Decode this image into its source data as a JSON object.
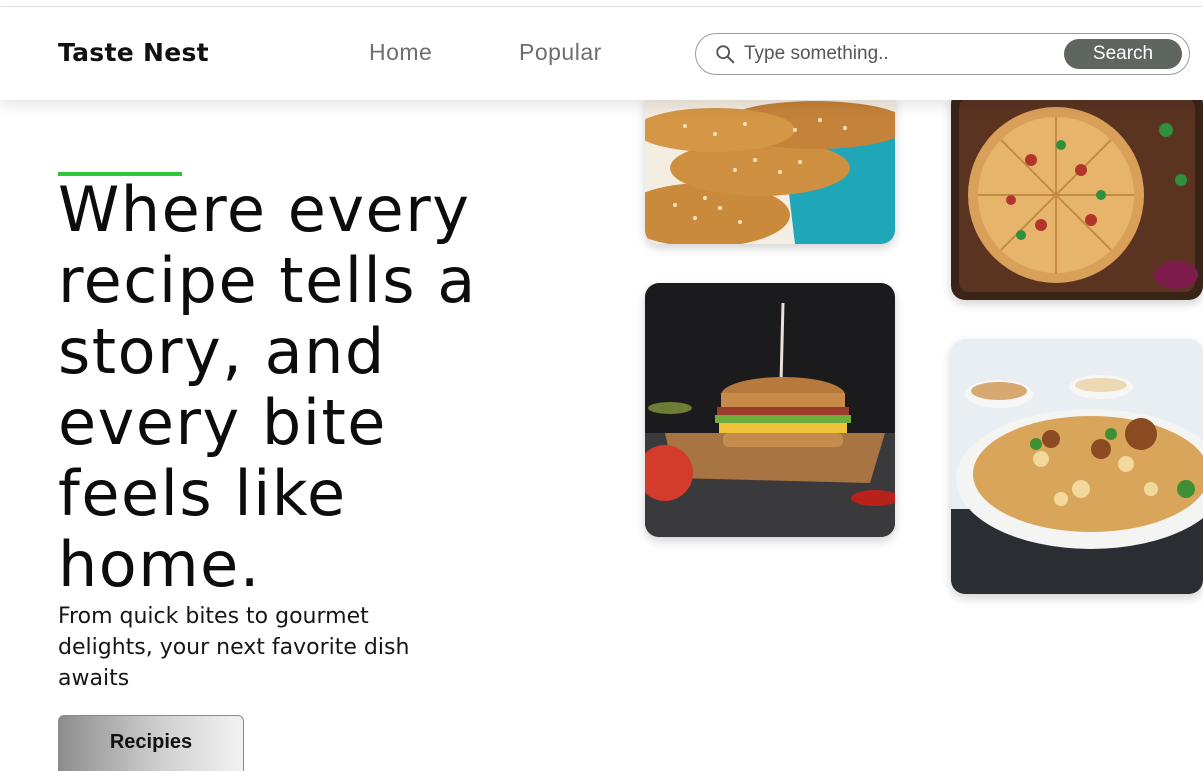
{
  "header": {
    "brand": "Taste Nest",
    "nav": [
      {
        "label": "Home"
      },
      {
        "label": "Popular"
      }
    ],
    "search": {
      "placeholder": "Type something..",
      "button_label": "Search"
    }
  },
  "hero": {
    "headline_lines": [
      "Where every",
      "recipe tells a",
      "story, and",
      "every bite",
      "feels like",
      "home."
    ],
    "subtitle_lines": [
      "From quick bites to gourmet",
      "delights, your next favorite dish",
      "awaits"
    ],
    "cta_label": "Recipies",
    "accent_color": "#2fc73a"
  },
  "gallery": {
    "images": [
      {
        "name": "sesame-bread-image"
      },
      {
        "name": "pizza-image"
      },
      {
        "name": "burger-image"
      },
      {
        "name": "biryani-image"
      }
    ]
  },
  "colors": {
    "search_button_bg": "#5f665f",
    "accent": "#2fc73a"
  }
}
